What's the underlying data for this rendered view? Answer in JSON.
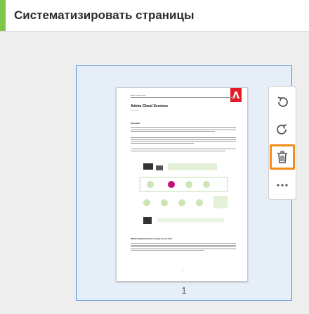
{
  "header": {
    "title": "Систематизировать страницы",
    "accent_color": "#7ec64a"
  },
  "thumbnail": {
    "page_number": "1",
    "selected": true,
    "selection_color": "#4a8ad8",
    "document": {
      "header_text": "Adobe Document Cloud",
      "title": "Adobe Cloud Services",
      "subtitle": "Solution brief",
      "section_overview": "Overview",
      "section_2": "Which Standards Does Adobe Focus On?",
      "footer_page": "1"
    }
  },
  "toolbar": {
    "items": [
      {
        "icon": "rotate-counterclockwise-icon"
      },
      {
        "icon": "rotate-clockwise-icon"
      },
      {
        "icon": "trash-icon",
        "highlighted": true,
        "highlight_color": "#f28c1a"
      },
      {
        "icon": "more-options-icon"
      }
    ]
  }
}
